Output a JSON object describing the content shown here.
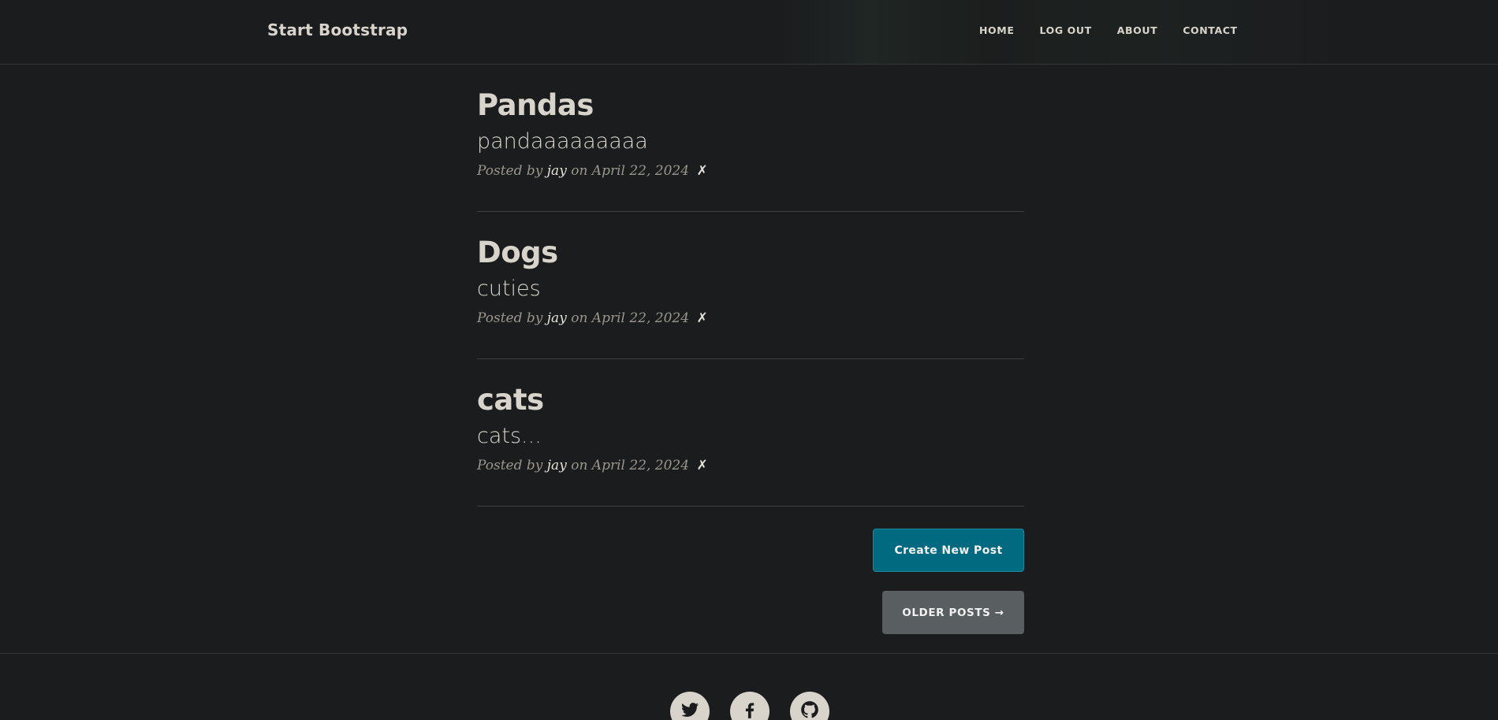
{
  "navbar": {
    "brand": "Start Bootstrap",
    "links": [
      "HOME",
      "LOG OUT",
      "ABOUT",
      "CONTACT"
    ]
  },
  "posts": [
    {
      "title": "Pandas",
      "subtitle": "pandaaaaaaaaa",
      "posted_by": "Posted by",
      "author": "jay",
      "on": "on April 22, 2024",
      "delete": "✗"
    },
    {
      "title": "Dogs",
      "subtitle": "cuties",
      "posted_by": "Posted by",
      "author": "jay",
      "on": "on April 22, 2024",
      "delete": "✗"
    },
    {
      "title": "cats",
      "subtitle": "cats...",
      "posted_by": "Posted by",
      "author": "jay",
      "on": "on April 22, 2024",
      "delete": "✗"
    }
  ],
  "buttons": {
    "create": "Create New Post",
    "older": "OLDER POSTS →"
  },
  "footer": {
    "social": [
      "twitter-icon",
      "facebook-icon",
      "github-icon"
    ]
  },
  "colors": {
    "background": "#1b1c1e",
    "create_button": "#026a80",
    "older_button": "#595e61",
    "text": "#d8d4cc"
  }
}
